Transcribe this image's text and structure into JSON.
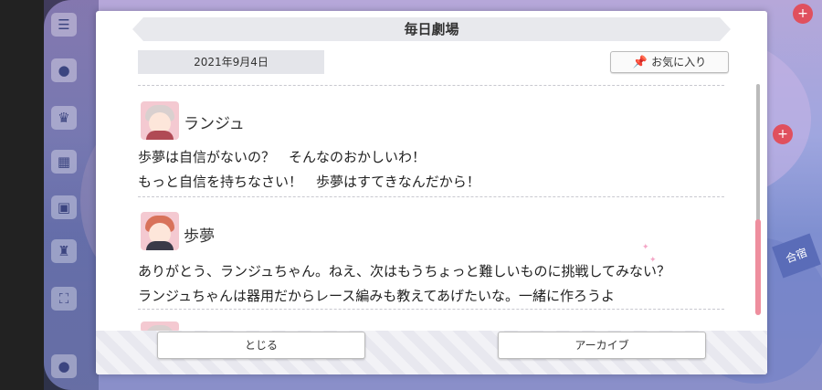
{
  "modal": {
    "title": "毎日劇場",
    "date": "2021年9月4日",
    "favorite_label": "お気に入り"
  },
  "messages": [
    {
      "speaker": "ランジュ",
      "lines": [
        "歩夢は自信がないの？　そんなのおかしいわ！",
        "もっと自信を持ちなさい！　歩夢はすてきなんだから！"
      ]
    },
    {
      "speaker": "歩夢",
      "lines": [
        "ありがとう、ランジュちゃん。ねえ、次はもうちょっと難しいものに挑戦してみない？",
        "ランジュちゃんは器用だからレース編みも教えてあげたいな。一緒に作ろうよ"
      ]
    }
  ],
  "footer": {
    "close_label": "とじる",
    "archive_label": "アーカイブ"
  },
  "background": {
    "badge_label": "合宿"
  },
  "colors": {
    "scroll_thumb": "#ee8e9e",
    "avatar_lanzhu_hair": "#d9d0cf",
    "avatar_ayumu_hair": "#d8725a"
  }
}
